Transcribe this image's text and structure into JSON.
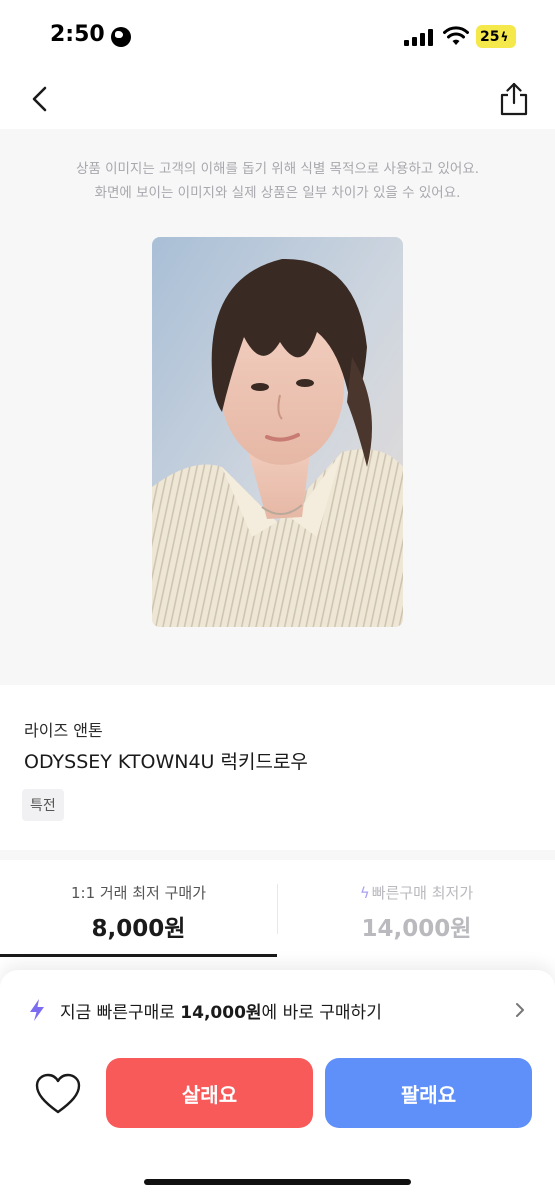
{
  "status_bar": {
    "time": "2:50",
    "battery": "25"
  },
  "nav": {
    "back_icon": "chevron-left-icon",
    "share_icon": "share-icon"
  },
  "image_notice": {
    "line1": "상품 이미지는 고객의 이해를 돕기 위해 식별 목적으로 사용하고 있어요.",
    "line2": "화면에 보이는 이미지와 실제 상품은 일부 차이가 있을 수 있어요."
  },
  "product": {
    "brand": "라이즈 앤톤",
    "title": "ODYSSEY KTOWN4U 럭키드로우",
    "tag": "특전"
  },
  "price_tabs": [
    {
      "label": "1:1 거래 최저 구매가",
      "value": "8,000원"
    },
    {
      "label": "빠른구매 최저가",
      "value": "14,000원"
    }
  ],
  "quick_buy": {
    "prefix": "지금 빠른구매로 ",
    "amount": "14,000원",
    "suffix": "에 바로 구매하기"
  },
  "actions": {
    "buy_label": "살래요",
    "sell_label": "팔래요"
  },
  "colors": {
    "buy": "#f85a5a",
    "sell": "#5f8ff8",
    "accent": "#7b6cf0",
    "battery": "#f4e84a"
  }
}
